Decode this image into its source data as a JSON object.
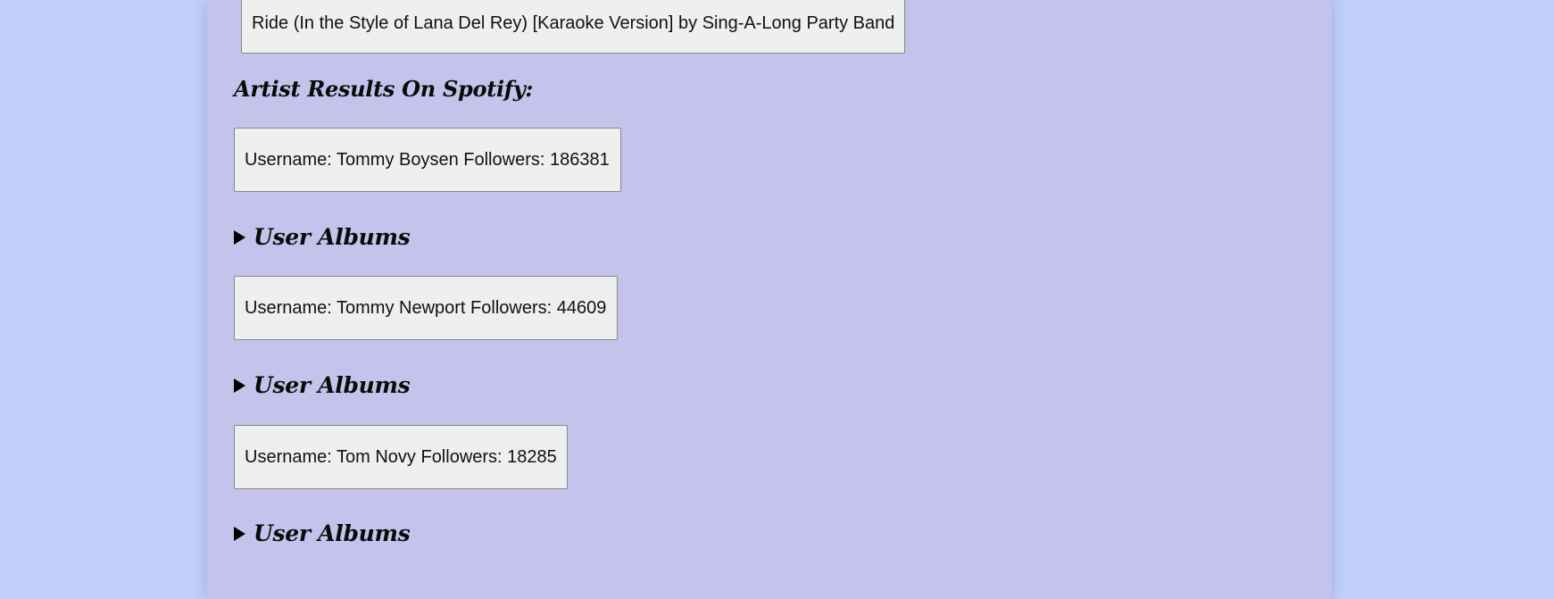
{
  "track_results": [
    {
      "text": "Ride (In the Style of Lana Del Rey) [Karaoke Version] by Sing-A-Long Party Band"
    }
  ],
  "artist_section": {
    "heading": "Artist Results On Spotify:",
    "artists": [
      {
        "text": "Username: Tommy Boysen Followers: 186381",
        "albums_label": "User Albums",
        "albums_expanded": false
      },
      {
        "text": "Username: Tommy Newport Followers: 44609",
        "albums_label": "User Albums",
        "albums_expanded": false
      },
      {
        "text": "Username: Tom Novy Followers: 18285",
        "albums_label": "User Albums",
        "albums_expanded": false
      }
    ]
  },
  "colors": {
    "page_background": "#c0d0f8",
    "panel_background": "#c3c3eb",
    "result_box_background": "#f0eff0"
  },
  "icons": {
    "disclosure": "triangle-right-icon"
  }
}
